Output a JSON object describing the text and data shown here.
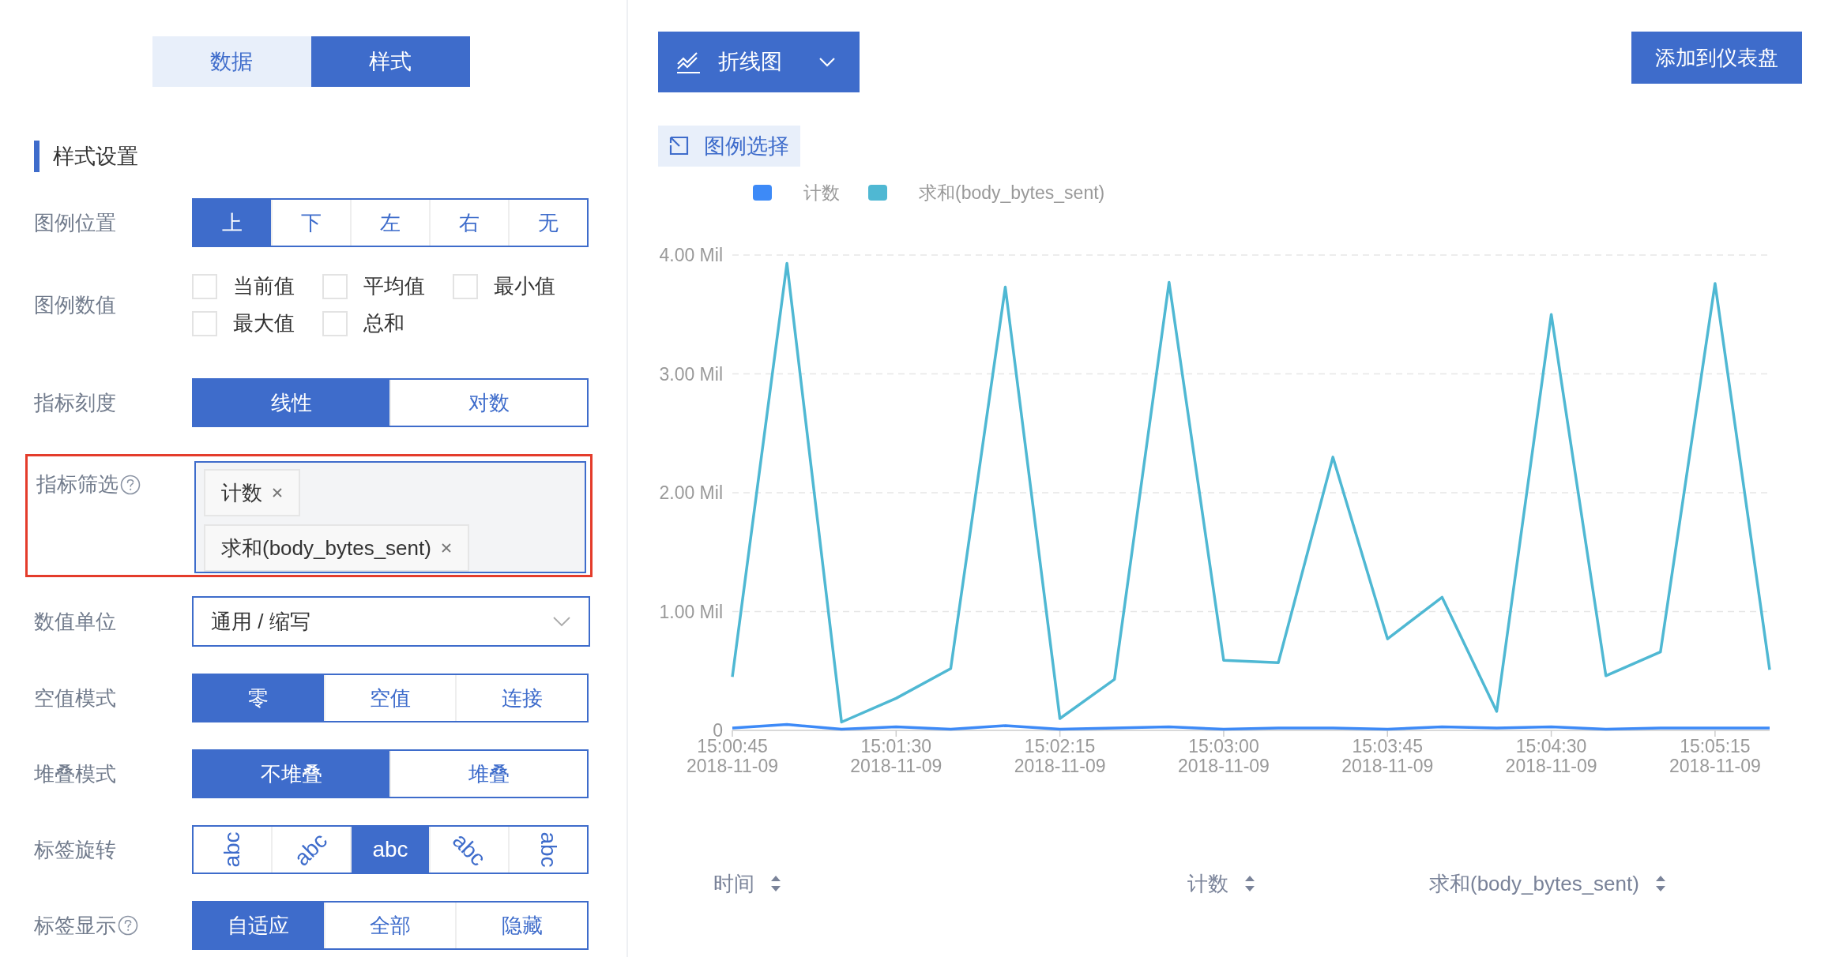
{
  "tabs": [
    {
      "label": "数据",
      "selected": false
    },
    {
      "label": "样式",
      "selected": true
    }
  ],
  "section_title": "样式设置",
  "settings": [
    {
      "kind": "segmented",
      "label": "图例位置",
      "help": false,
      "options": [
        {
          "label": "上",
          "selected": true
        },
        {
          "label": "下",
          "selected": false
        },
        {
          "label": "左",
          "selected": false
        },
        {
          "label": "右",
          "selected": false
        },
        {
          "label": "无",
          "selected": false
        }
      ]
    },
    {
      "kind": "checkboxes",
      "label": "图例数值",
      "help": false,
      "options": [
        {
          "label": "当前值",
          "checked": false
        },
        {
          "label": "平均值",
          "checked": false
        },
        {
          "label": "最小值",
          "checked": false
        },
        {
          "label": "最大值",
          "checked": false
        },
        {
          "label": "总和",
          "checked": false
        }
      ]
    },
    {
      "kind": "segmented",
      "label": "指标刻度",
      "help": false,
      "options": [
        {
          "label": "线性",
          "selected": true
        },
        {
          "label": "对数",
          "selected": false
        }
      ]
    },
    {
      "kind": "tags",
      "label": "指标筛选",
      "help": true,
      "highlighted": true,
      "tags": [
        "计数",
        "求和(body_bytes_sent)"
      ]
    },
    {
      "kind": "select",
      "label": "数值单位",
      "help": false,
      "value": "通用 / 缩写"
    },
    {
      "kind": "segmented",
      "label": "空值模式",
      "help": false,
      "options": [
        {
          "label": "零",
          "selected": true
        },
        {
          "label": "空值",
          "selected": false
        },
        {
          "label": "连接",
          "selected": false
        }
      ]
    },
    {
      "kind": "segmented",
      "label": "堆叠模式",
      "help": false,
      "options": [
        {
          "label": "不堆叠",
          "selected": true
        },
        {
          "label": "堆叠",
          "selected": false
        }
      ]
    },
    {
      "kind": "rotation",
      "label": "标签旋转",
      "help": false,
      "options": [
        {
          "label": "abc",
          "kind": "up",
          "selected": false
        },
        {
          "label": "abc",
          "kind": "up-diagonal",
          "selected": false
        },
        {
          "label": "abc",
          "kind": "flat",
          "selected": true
        },
        {
          "label": "abc",
          "kind": "down-diagonal",
          "selected": false
        },
        {
          "label": "abc",
          "kind": "down",
          "selected": false
        }
      ]
    },
    {
      "kind": "segmented",
      "label": "标签显示",
      "help": true,
      "options": [
        {
          "label": "自适应",
          "selected": true
        },
        {
          "label": "全部",
          "selected": false
        },
        {
          "label": "隐藏",
          "selected": false
        }
      ]
    }
  ],
  "chart_type": {
    "label": "折线图"
  },
  "add_button": "添加到仪表盘",
  "legend_select": "图例选择",
  "chart": {
    "chart_data": {
      "type": "line",
      "categories": [
        "15:00:45\n2018-11-09",
        null,
        null,
        "15:01:30\n2018-11-09",
        null,
        null,
        "15:02:15\n2018-11-09",
        null,
        null,
        "15:03:00\n2018-11-09",
        null,
        null,
        "15:03:45\n2018-11-09",
        null,
        null,
        "15:04:30\n2018-11-09",
        null,
        null,
        "15:05:15\n2018-11-09",
        null
      ],
      "series": [
        {
          "name": "计数",
          "color": "#3d8af7",
          "values": [
            0.02,
            0.05,
            0.01,
            0.03,
            0.01,
            0.04,
            0.01,
            0.02,
            0.03,
            0.01,
            0.02,
            0.02,
            0.01,
            0.03,
            0.02,
            0.03,
            0.01,
            0.02,
            0.02,
            0.02
          ]
        },
        {
          "name": "求和(body_bytes_sent)",
          "color": "#4fb8d3",
          "values": [
            0.45,
            3.93,
            0.07,
            0.27,
            0.52,
            3.73,
            0.1,
            0.43,
            3.77,
            0.59,
            0.57,
            2.3,
            0.77,
            1.12,
            0.16,
            3.5,
            0.46,
            0.66,
            3.76,
            0.51
          ]
        }
      ],
      "grid": true,
      "ylim": [
        0,
        4
      ],
      "yticks": [
        0,
        {
          "value": 1,
          "label": "1.00 Mil"
        },
        {
          "value": 2,
          "label": "2.00 Mil"
        },
        {
          "value": 3,
          "label": "3.00 Mil"
        },
        {
          "value": 4,
          "label": "4.00 Mil"
        }
      ]
    }
  },
  "table": {
    "columns": [
      "时间",
      "计数",
      "求和(body_bytes_sent)"
    ]
  }
}
